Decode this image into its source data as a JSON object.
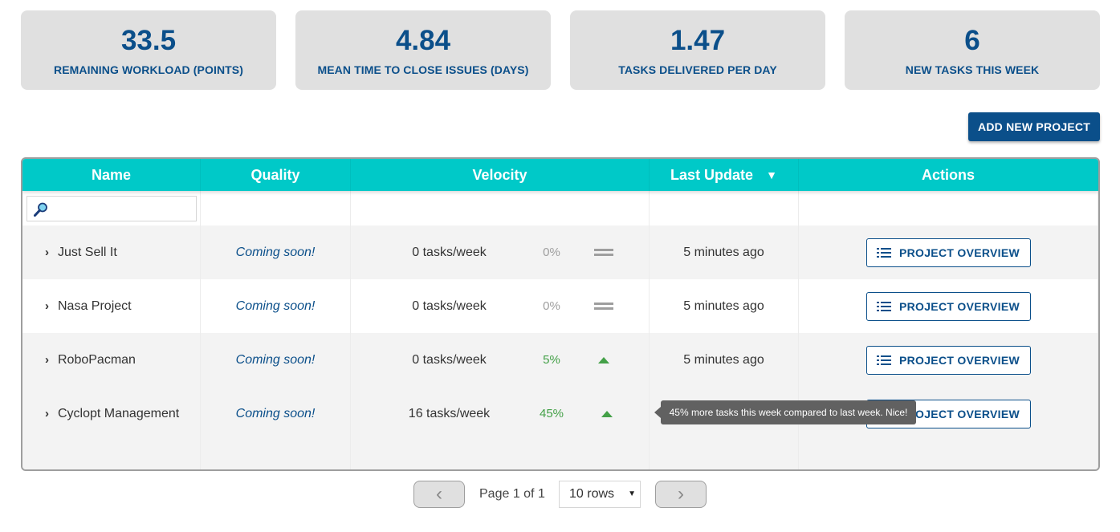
{
  "stats": [
    {
      "value": "33.5",
      "label": "REMAINING WORKLOAD (POINTS)"
    },
    {
      "value": "4.84",
      "label": "MEAN TIME TO CLOSE ISSUES (DAYS)"
    },
    {
      "value": "1.47",
      "label": "TASKS DELIVERED PER DAY"
    },
    {
      "value": "6",
      "label": "NEW TASKS THIS WEEK"
    }
  ],
  "add_button": {
    "label": "ADD NEW PROJECT"
  },
  "table": {
    "headers": {
      "name": "Name",
      "quality": "Quality",
      "velocity": "Velocity",
      "last_update": "Last Update",
      "actions": "Actions"
    },
    "sort_indicator": "▼",
    "rows": [
      {
        "name": "Just Sell It",
        "quality": "Coming soon!",
        "velocity": "0 tasks/week",
        "change": "0%",
        "trend": "flat",
        "last_update": "5 minutes ago",
        "action": "PROJECT OVERVIEW"
      },
      {
        "name": "Nasa Project",
        "quality": "Coming soon!",
        "velocity": "0 tasks/week",
        "change": "0%",
        "trend": "flat",
        "last_update": "5 minutes ago",
        "action": "PROJECT OVERVIEW"
      },
      {
        "name": "RoboPacman",
        "quality": "Coming soon!",
        "velocity": "0 tasks/week",
        "change": "5%",
        "trend": "up",
        "last_update": "5 minutes ago",
        "action": "PROJECT OVERVIEW"
      },
      {
        "name": "Cyclopt Management",
        "quality": "Coming soon!",
        "velocity": "16 tasks/week",
        "change": "45%",
        "trend": "up",
        "last_update": "",
        "action": "PROJECT OVERVIEW"
      }
    ]
  },
  "tooltip": {
    "text": "45% more tasks this week compared to last week. Nice!"
  },
  "pagination": {
    "prev": "‹",
    "next": "›",
    "page_text": "Page 1 of 1",
    "rows_selected": "10 rows"
  },
  "colors": {
    "primary": "#0b4f8a",
    "header": "#00c9c8",
    "up": "#43a047",
    "flat": "#9e9e9e"
  }
}
